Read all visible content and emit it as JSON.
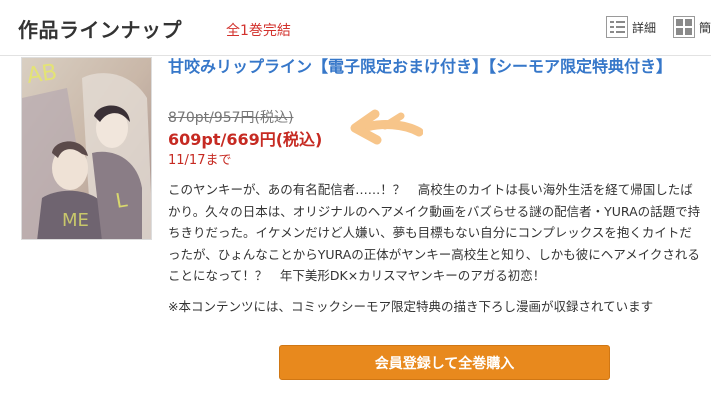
{
  "header": {
    "title": "作品ラインナップ",
    "status": "全1巻完結",
    "view_detail_label": "詳細",
    "view_grid_label": "簡"
  },
  "book": {
    "title": "甘咬みリップライン【電子限定おまけ付き】【シーモア限定特典付き】",
    "price_original": "870pt/957円(税込)",
    "price_sale": "609pt/669円(税込)",
    "sale_deadline": "11/17まで",
    "description": "このヤンキーが、あの有名配信者……！？　高校生のカイトは長い海外生活を経て帰国したばかり。久々の日本は、オリジナルのヘアメイク動画をバズらせる謎の配信者・YURAの話題で持ちきりだった。イケメンだけど人嫌い、夢も目標もない自分にコンプレックスを抱くカイトだったが、ひょんなことからYURAの正体がヤンキー高校生と知り、しかも彼にヘアメイクされることになって！？　年下美形DK×カリスマヤンキーのアガる初恋！",
    "notice": "※本コンテンツには、コミックシーモア限定特典の描き下ろし漫画が収録されています"
  },
  "actions": {
    "purchase_label": "会員登録して全巻購入"
  },
  "colors": {
    "title_link": "#3677c9",
    "sale_price": "#c62a22",
    "button": "#e8891d",
    "arrow": "#f7c58a"
  }
}
